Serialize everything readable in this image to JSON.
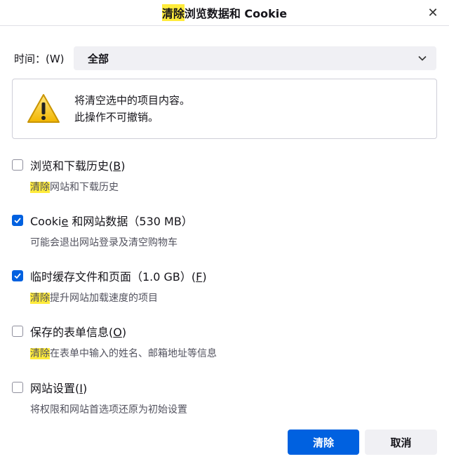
{
  "dialog": {
    "title_highlight": "清除",
    "title_rest": "浏览数据和 Cookie",
    "close_glyph": "✕"
  },
  "time": {
    "label": "时间：(W)",
    "selected": "全部"
  },
  "warning": {
    "line1": "将清空选中的项目内容。",
    "line2": "此操作不可撤销。"
  },
  "options": [
    {
      "label_pre": "浏览和下载历史(",
      "key": "B",
      "label_post": ")",
      "checked": false,
      "desc_highlight": "清除",
      "desc_rest": "网站和下载历史"
    },
    {
      "label_pre": "Cooki",
      "key": "e",
      "label_post": " 和网站数据（530 MB）",
      "checked": true,
      "desc_highlight": "",
      "desc_rest": "可能会退出网站登录及清空购物车"
    },
    {
      "label_pre": "临时缓存文件和页面（1.0 GB）(",
      "key": "F",
      "label_post": ")",
      "checked": true,
      "desc_highlight": "清除",
      "desc_rest": "提升网站加载速度的项目"
    },
    {
      "label_pre": "保存的表单信息(",
      "key": "O",
      "label_post": ")",
      "checked": false,
      "desc_highlight": "清除",
      "desc_rest": "在表单中输入的姓名、邮箱地址等信息"
    },
    {
      "label_pre": "网站设置(",
      "key": "I",
      "label_post": ")",
      "checked": false,
      "desc_highlight": "",
      "desc_rest": "将权限和网站首选项还原为初始设置"
    }
  ],
  "buttons": {
    "clear": "清除",
    "cancel": "取消"
  },
  "colors": {
    "accent": "#0061e0",
    "highlight": "#ffeb3b"
  }
}
